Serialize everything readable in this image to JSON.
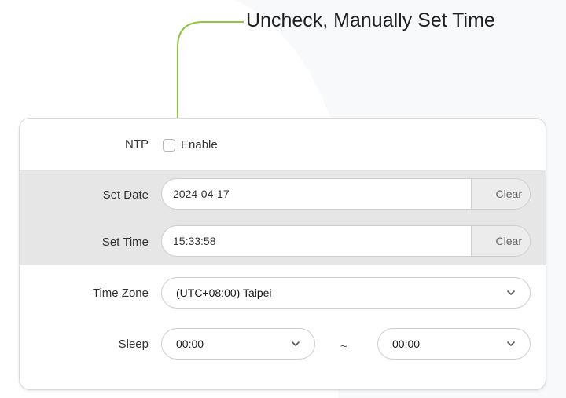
{
  "annotation": {
    "text": "Uncheck, Manually Set Time"
  },
  "ntp": {
    "label": "NTP",
    "checkbox_checked": false,
    "checkbox_label": "Enable"
  },
  "set_date": {
    "label": "Set Date",
    "value": "2024-04-17",
    "clear_label": "Clear"
  },
  "set_time": {
    "label": "Set Time",
    "value": "15:33:58",
    "clear_label": "Clear"
  },
  "time_zone": {
    "label": "Time Zone",
    "value": "(UTC+08:00) Taipei"
  },
  "sleep": {
    "label": "Sleep",
    "start": "00:00",
    "separator": "~",
    "end": "00:00"
  },
  "colors": {
    "accent_line": "#8cc63f",
    "panel_border": "#d9d9d9",
    "manual_bg": "#e6e6e6"
  },
  "icons": {
    "dropdown": "chevron-down-icon"
  }
}
